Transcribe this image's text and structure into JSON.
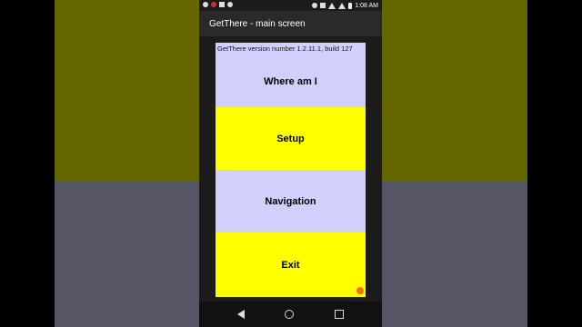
{
  "status_bar": {
    "time": "1:08 AM"
  },
  "app_bar": {
    "title": "GetThere - main screen"
  },
  "main": {
    "version_text": "GetThere version number 1.2.11.1, build 127",
    "buttons": [
      {
        "label": "Where am I",
        "color": "#d1d0fd"
      },
      {
        "label": "Setup",
        "color": "#ffff00"
      },
      {
        "label": "Navigation",
        "color": "#d1d0fd"
      },
      {
        "label": "Exit",
        "color": "#ffff00"
      }
    ]
  },
  "colors": {
    "lavender": "#d1d0fd",
    "yellow": "#ffff00",
    "accent_dot": "#ff6a00"
  },
  "icons": {
    "nav": [
      "back-icon",
      "home-icon",
      "recents-icon"
    ]
  }
}
